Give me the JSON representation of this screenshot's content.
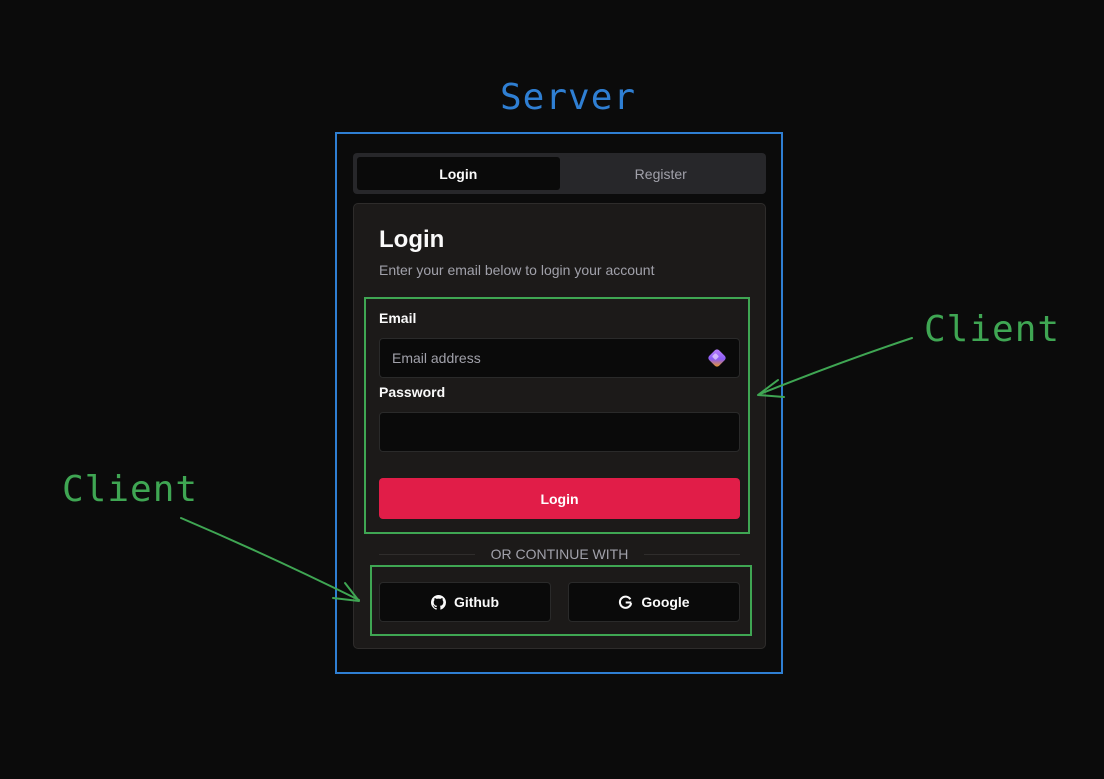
{
  "annotations": {
    "server": "Server",
    "client_right": "Client",
    "client_left": "Client"
  },
  "tabs": [
    {
      "label": "Login",
      "active": true
    },
    {
      "label": "Register",
      "active": false
    }
  ],
  "card": {
    "title": "Login",
    "description": "Enter your email below to login your account"
  },
  "form": {
    "email_label": "Email",
    "email_placeholder": "Email address",
    "password_label": "Password",
    "submit_label": "Login"
  },
  "divider": "OR CONTINUE WITH",
  "social": {
    "github_label": "Github",
    "github_icon": "github-icon",
    "google_label": "Google",
    "google_icon": "google-icon"
  },
  "colors": {
    "server_box": "#2f7fd3",
    "client_box": "#3fa653",
    "primary_button": "#e11d48",
    "background": "#0b0b0b",
    "card": "#1c1a19"
  }
}
